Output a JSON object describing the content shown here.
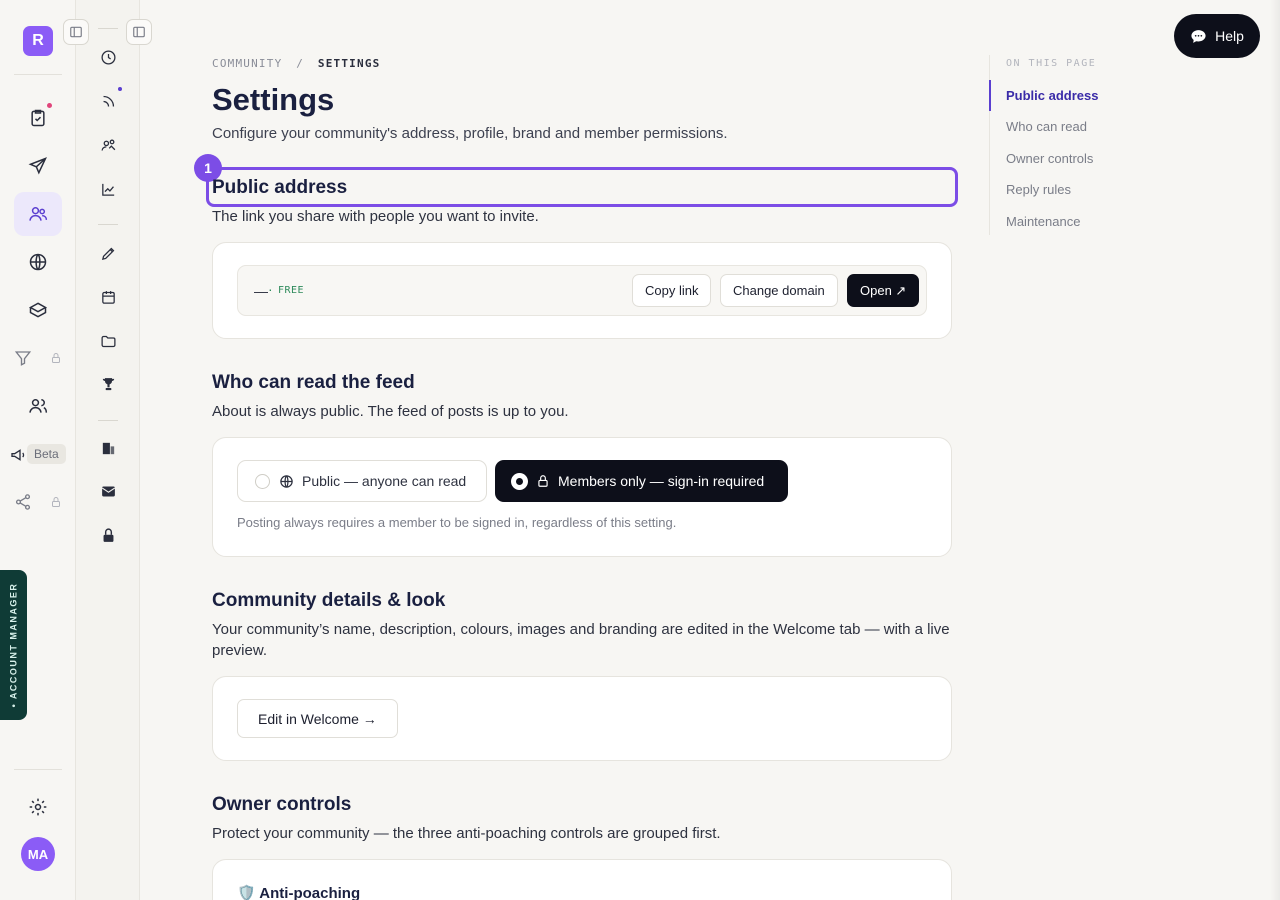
{
  "rail": {
    "logo_letter": "R",
    "beta_label": "Beta",
    "account_manager_label": "• ACCOUNT MANAGER",
    "avatar_initials": "MA",
    "accent_color": "#8b5cf6"
  },
  "breadcrumb": {
    "parent": "COMMUNITY",
    "separator": "/",
    "current": "SETTINGS"
  },
  "page": {
    "title": "Settings",
    "subtitle": "Configure your community's address, profile, brand and member permissions."
  },
  "highlight_badge": "1",
  "sections": {
    "public_address": {
      "title": "Public address",
      "desc": "The link you share with people you want to invite.",
      "address_value": "—",
      "dot": "·",
      "plan_badge": "FREE",
      "copy_label": "Copy link",
      "change_label": "Change domain",
      "open_label": "Open ↗"
    },
    "who_can_read": {
      "title": "Who can read the feed",
      "desc": "About is always public. The feed of posts is up to you.",
      "option_public": "Public — anyone can read",
      "option_members": "Members only — sign-in required",
      "selected": "members",
      "note": "Posting always requires a member to be signed in, regardless of this setting."
    },
    "details": {
      "title": "Community details & look",
      "desc": "Your community’s name, description, colours, images and branding are edited in the Welcome tab — with a live preview.",
      "button_label": "Edit in Welcome →"
    },
    "owner_controls": {
      "title": "Owner controls",
      "desc": "Protect your community — the three anti-poaching controls are grouped first.",
      "card_title": "🛡️ Anti-poaching"
    }
  },
  "toc": {
    "title": "ON THIS PAGE",
    "items": [
      "Public address",
      "Who can read",
      "Owner controls",
      "Reply rules",
      "Maintenance"
    ],
    "active_index": 0
  },
  "help_label": "Help"
}
